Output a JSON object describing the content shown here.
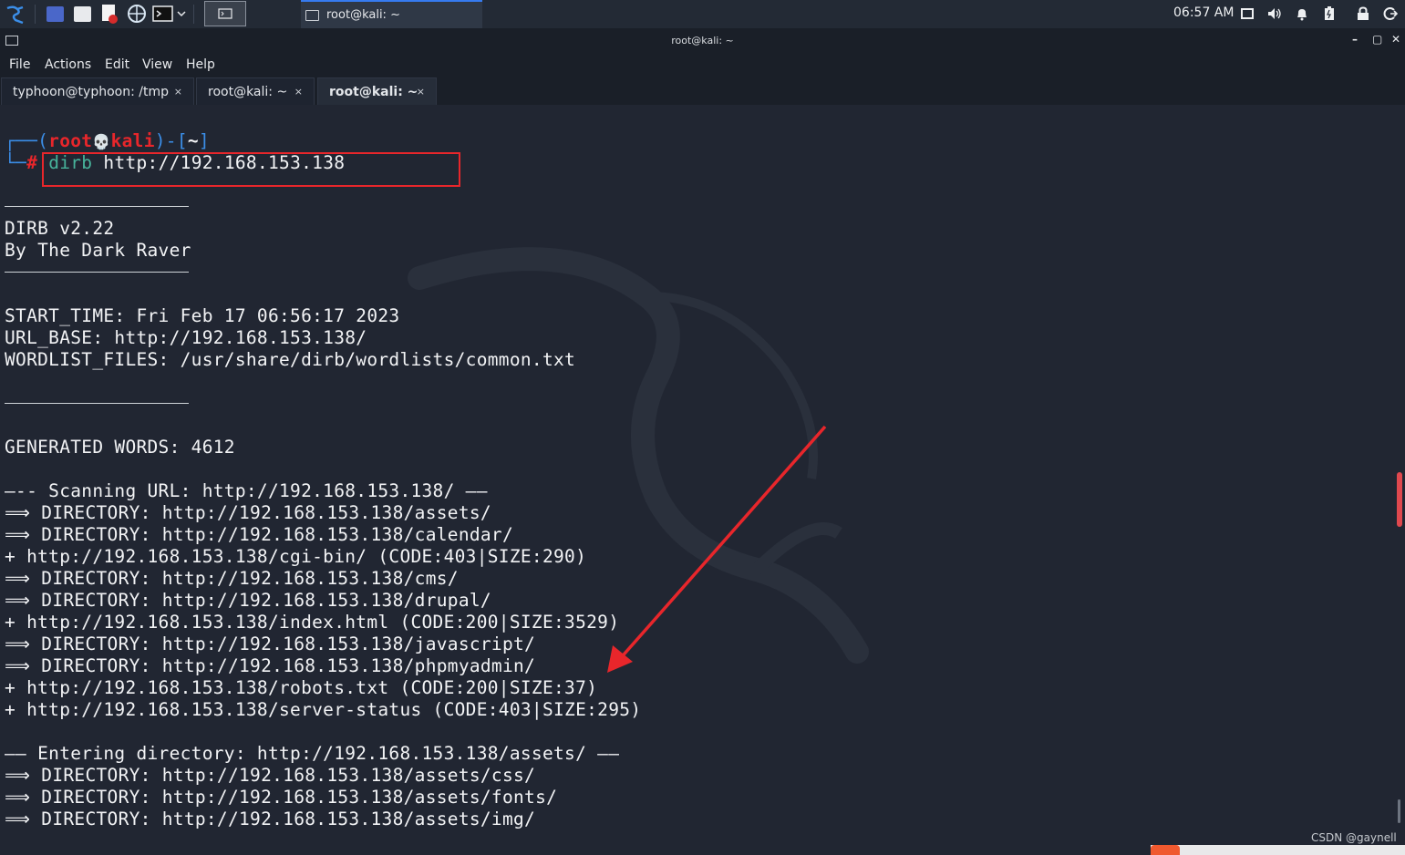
{
  "taskbar": {
    "task_title": "root@kali: ~",
    "clock": "06:57 AM"
  },
  "window": {
    "title": "root@kali: ~",
    "controls": [
      "–",
      "▢",
      "✕"
    ]
  },
  "menu": [
    "File",
    "Actions",
    "Edit",
    "View",
    "Help"
  ],
  "tabs": [
    {
      "label": "typhoon@typhoon: /tmp",
      "close": "×"
    },
    {
      "label": "root@kali: ~",
      "close": "×"
    },
    {
      "label": "root@kali: ~",
      "close": "×"
    }
  ],
  "prompt": {
    "open": "┌──(",
    "user": "root",
    "skull": "💀",
    "host": "kali",
    "mid": ")-[",
    "dir": "~",
    "close": "]",
    "corner": "└─",
    "hash": "#",
    "cmd": "dirb",
    "arg": " http://192.168.153.138"
  },
  "lines": [
    "DIRB v2.22",
    "By The Dark Raver",
    "START_TIME: Fri Feb 17 06:56:17 2023",
    "URL_BASE: http://192.168.153.138/",
    "WORDLIST_FILES: /usr/share/dirb/wordlists/common.txt",
    "GENERATED WORDS: 4612",
    "—-- Scanning URL: http://192.168.153.138/ ——",
    "⟹ DIRECTORY: http://192.168.153.138/assets/",
    "⟹ DIRECTORY: http://192.168.153.138/calendar/",
    "+ http://192.168.153.138/cgi-bin/ (CODE:403|SIZE:290)",
    "⟹ DIRECTORY: http://192.168.153.138/cms/",
    "⟹ DIRECTORY: http://192.168.153.138/drupal/",
    "+ http://192.168.153.138/index.html (CODE:200|SIZE:3529)",
    "⟹ DIRECTORY: http://192.168.153.138/javascript/",
    "⟹ DIRECTORY: http://192.168.153.138/phpmyadmin/",
    "+ http://192.168.153.138/robots.txt (CODE:200|SIZE:37)",
    "+ http://192.168.153.138/server-status (CODE:403|SIZE:295)",
    "—— Entering directory: http://192.168.153.138/assets/ ——",
    "⟹ DIRECTORY: http://192.168.153.138/assets/css/",
    "⟹ DIRECTORY: http://192.168.153.138/assets/fonts/",
    "⟹ DIRECTORY: http://192.168.153.138/assets/img/"
  ],
  "watermark": "CSDN @gaynell",
  "colors": {
    "accent_blue": "#367bf0",
    "annotation_red": "#e8262b",
    "prompt_blue": "#3b8ee8",
    "command_teal": "#47b39b"
  },
  "icons": [
    "kali-menu-icon",
    "workspace-icon",
    "file-manager-icon",
    "text-editor-icon",
    "browser-icon",
    "terminal-icon",
    "display-icon",
    "volume-icon",
    "bell-icon",
    "battery-icon",
    "lock-icon",
    "logout-icon"
  ]
}
